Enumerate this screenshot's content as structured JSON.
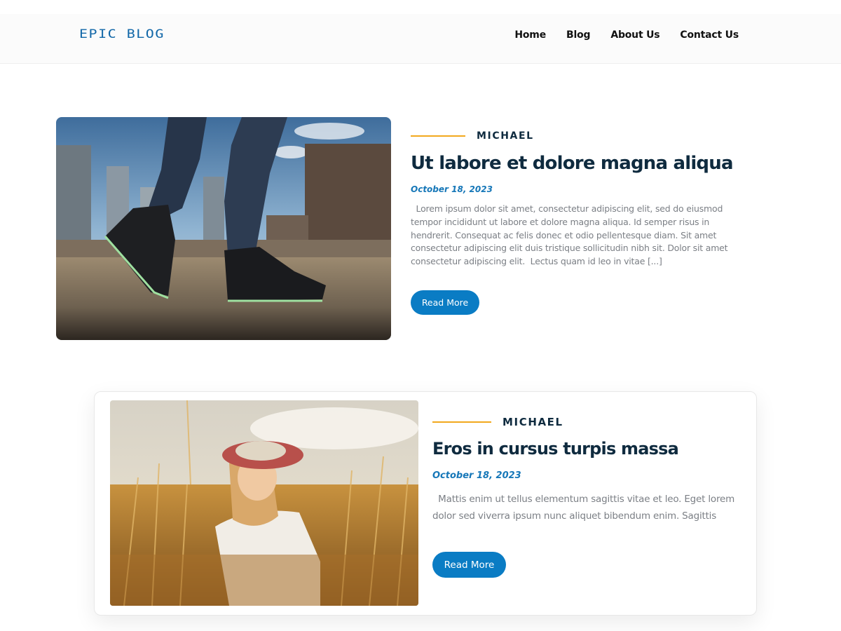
{
  "header": {
    "logo": "EPIC BLOG",
    "nav": [
      {
        "label": "Home"
      },
      {
        "label": "Blog"
      },
      {
        "label": "About Us"
      },
      {
        "label": "Contact Us"
      }
    ]
  },
  "posts": [
    {
      "author": "MICHAEL",
      "title": "Ut labore et dolore magna aliqua",
      "date": "October 18, 2023",
      "excerpt_lines": [
        "  Lorem ipsum dolor sit amet, consectetur adipiscing elit, sed do eiusmod",
        "tempor incididunt ut labore et dolore magna aliqua. Id semper risus in",
        "hendrerit. Consequat ac felis donec et odio pellentesque diam. Sit amet",
        "consectetur adipiscing elit duis tristique sollicitudin nibh sit. Dolor sit amet",
        "consectetur adipiscing elit.  Lectus quam id leo in vitae [...]"
      ],
      "button": "Read More",
      "image": "sneaker-city-photo"
    },
    {
      "author": "MICHAEL",
      "title": "Eros in cursus turpis massa",
      "date": "October 18, 2023",
      "excerpt_lines": [
        "  Mattis enim ut tellus elementum sagittis vitae et leo. Eget lorem",
        "dolor sed viverra ipsum nunc aliquet bibendum enim. Sagittis"
      ],
      "button": "Read More",
      "image": "woman-wheat-field-photo"
    }
  ],
  "colors": {
    "accent": "#0a7cc4",
    "meta_line": "#f2a81d",
    "title": "#0f2b3f",
    "date": "#1677b8",
    "excerpt": "#7b7f85"
  }
}
